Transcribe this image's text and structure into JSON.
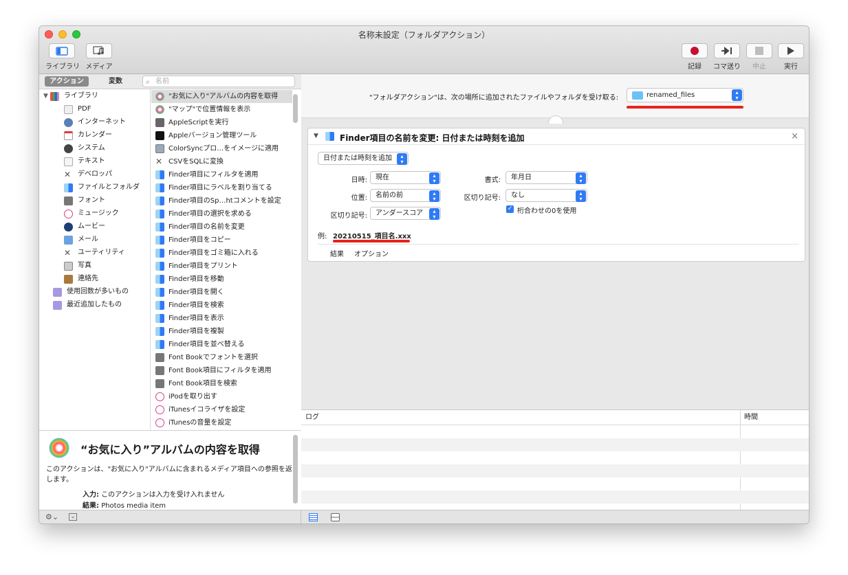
{
  "window": {
    "title": "名称未設定（フォルダアクション）"
  },
  "toolbar": {
    "library_label": "ライブラリ",
    "media_label": "メディア",
    "record_label": "記録",
    "step_label": "コマ送り",
    "stop_label": "中止",
    "run_label": "実行"
  },
  "library": {
    "tab_actions": "アクション",
    "tab_variables": "変数",
    "search_placeholder": "名前",
    "root": "ライブラリ",
    "categories": [
      "PDF",
      "インターネット",
      "カレンダー",
      "システム",
      "テキスト",
      "デベロッパ",
      "ファイルとフォルダ",
      "フォント",
      "ミュージック",
      "ムービー",
      "メール",
      "ユーティリティ",
      "写真",
      "連絡先"
    ],
    "smart_groups": [
      "使用回数が多いもの",
      "最近追加したもの"
    ]
  },
  "actions": [
    "\"お気に入り\"アルバムの内容を取得",
    "\"マップ\"で位置情報を表示",
    "AppleScriptを実行",
    "Appleバージョン管理ツール",
    "ColorSyncプロ…をイメージに適用",
    "CSVをSQLに変換",
    "Finder項目にフィルタを適用",
    "Finder項目にラベルを割り当てる",
    "Finder項目のSp…htコメントを設定",
    "Finder項目の選択を求める",
    "Finder項目の名前を変更",
    "Finder項目をコピー",
    "Finder項目をゴミ箱に入れる",
    "Finder項目をプリント",
    "Finder項目を移動",
    "Finder項目を開く",
    "Finder項目を検索",
    "Finder項目を表示",
    "Finder項目を複製",
    "Finder項目を並べ替える",
    "Font Bookでフォントを選択",
    "Font Book項目にフィルタを適用",
    "Font Book項目を検索",
    "iPodを取り出す",
    "iTunesイコライザを設定",
    "iTunesの音量を設定"
  ],
  "description": {
    "title": "“お気に入り”アルバムの内容を取得",
    "body": "このアクションは、\"お気に入り\"アルバムに含まれるメディア項目への参照を返します。",
    "input_label": "入力:",
    "input_value": "このアクションは入力を受け入れません",
    "result_label": "結果:",
    "result_value": "Photos media item"
  },
  "workflow": {
    "caption": "\"フォルダアクション\"は、次の場所に追加されたファイルやフォルダを受け取る:",
    "folder": "renamed_files",
    "action_title": "Finder項目の名前を変更: 日付または時刻を追加",
    "mode": "日付または時刻を追加",
    "date_label": "日時:",
    "date_value": "現在",
    "position_label": "位置:",
    "position_value": "名前の前",
    "separator_label": "区切り記号:",
    "separator_value": "アンダースコア",
    "format_label": "書式:",
    "format_value": "年月日",
    "separator2_label": "区切り記号:",
    "separator2_value": "なし",
    "zero_pad_label": "桁合わせの0を使用",
    "zero_pad_checked": true,
    "example_label": "例:",
    "example_value": "20210515_項目名.xxx",
    "tab_results": "結果",
    "tab_options": "オプション"
  },
  "log": {
    "col_log": "ログ",
    "col_time": "時間"
  },
  "colors": {
    "accent": "#2f7bf5",
    "highlight": "#e8231b",
    "record": "#c8102e"
  }
}
